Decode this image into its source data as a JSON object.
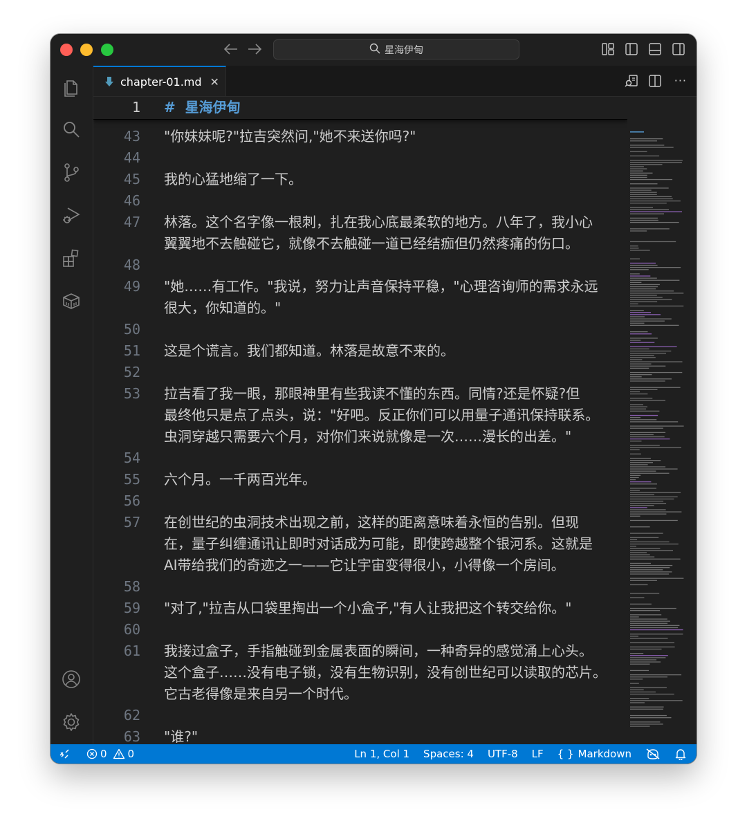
{
  "window": {
    "search": "星海伊甸",
    "colors": {
      "accent": "#0078d4",
      "heading": "#569cd6",
      "background": "#1f1f1f"
    }
  },
  "activity_bar": {
    "icons": [
      "files-icon",
      "search-icon",
      "source-control-icon",
      "run-debug-icon",
      "extensions-icon",
      "remote-explorer-icon",
      "account-icon",
      "settings-gear-icon"
    ]
  },
  "tab": {
    "label": "chapter-01.md",
    "close": "✕"
  },
  "editor": {
    "sticky": {
      "num": "1",
      "text": "#  星海伊甸"
    },
    "lines": [
      {
        "num": "43",
        "text": "\"你妹妹呢?\"拉吉突然问,\"她不来送你吗?\""
      },
      {
        "num": "44",
        "text": ""
      },
      {
        "num": "45",
        "text": "我的心猛地缩了一下。"
      },
      {
        "num": "46",
        "text": ""
      },
      {
        "num": "47",
        "text": "林落。这个名字像一根刺，扎在我心底最柔软的地方。八年了，我小心"
      },
      {
        "num": "",
        "text": "翼翼地不去触碰它，就像不去触碰一道已经结痂但仍然疼痛的伤口。"
      },
      {
        "num": "48",
        "text": ""
      },
      {
        "num": "49",
        "text": "\"她……有工作。\"我说，努力让声音保持平稳，\"心理咨询师的需求永远"
      },
      {
        "num": "",
        "text": "很大，你知道的。\""
      },
      {
        "num": "50",
        "text": ""
      },
      {
        "num": "51",
        "text": "这是个谎言。我们都知道。林落是故意不来的。"
      },
      {
        "num": "52",
        "text": ""
      },
      {
        "num": "53",
        "text": "拉吉看了我一眼，那眼神里有些我读不懂的东西。同情?还是怀疑?但"
      },
      {
        "num": "",
        "text": "最终他只是点了点头，说：\"好吧。反正你们可以用量子通讯保持联系。"
      },
      {
        "num": "",
        "text": "虫洞穿越只需要六个月，对你们来说就像是一次……漫长的出差。\""
      },
      {
        "num": "54",
        "text": ""
      },
      {
        "num": "55",
        "text": "六个月。一千两百光年。"
      },
      {
        "num": "56",
        "text": ""
      },
      {
        "num": "57",
        "text": "在创世纪的虫洞技术出现之前，这样的距离意味着永恒的告别。但现"
      },
      {
        "num": "",
        "text": "在，量子纠缠通讯让即时对话成为可能，即使跨越整个银河系。这就是"
      },
      {
        "num": "",
        "text": "AI带给我们的奇迹之一——它让宇宙变得很小，小得像一个房间。"
      },
      {
        "num": "58",
        "text": ""
      },
      {
        "num": "59",
        "text": "\"对了,\"拉吉从口袋里掏出一个小盒子,\"有人让我把这个转交给你。\""
      },
      {
        "num": "60",
        "text": ""
      },
      {
        "num": "61",
        "text": "我接过盒子，手指触碰到金属表面的瞬间，一种奇异的感觉涌上心头。"
      },
      {
        "num": "",
        "text": "这个盒子……没有电子锁，没有生物识别，没有创世纪可以读取的芯片。"
      },
      {
        "num": "",
        "text": "它古老得像是来自另一个时代。"
      },
      {
        "num": "62",
        "text": ""
      },
      {
        "num": "63",
        "text": "\"谁?\""
      }
    ]
  },
  "status_bar": {
    "errors": "0",
    "warnings": "0",
    "position": "Ln 1, Col 1",
    "spaces": "Spaces: 4",
    "encoding": "UTF-8",
    "eol": "LF",
    "language_brace": "{ }",
    "language": "Markdown"
  }
}
